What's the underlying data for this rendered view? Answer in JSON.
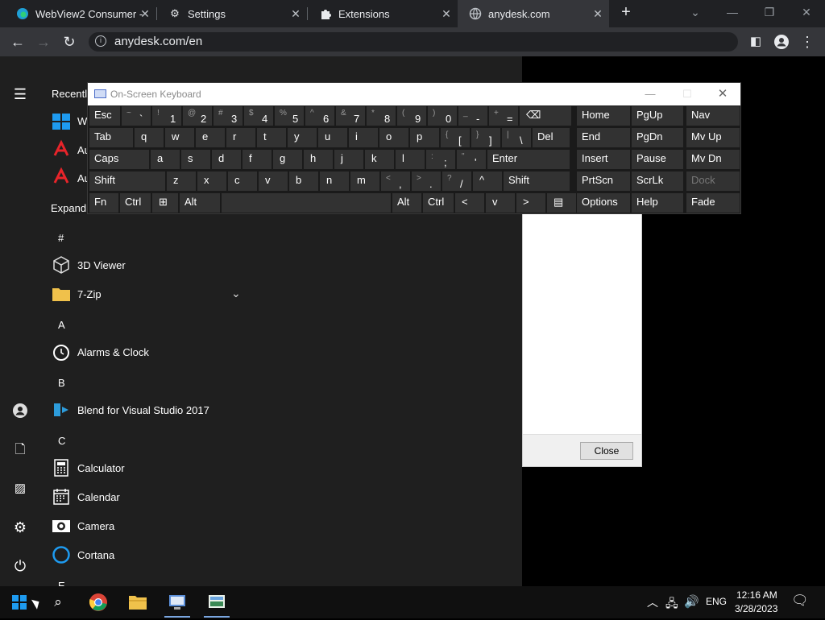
{
  "browser": {
    "tabs": [
      {
        "label": "WebView2 Consumer -",
        "icon": "edge-icon"
      },
      {
        "label": "Settings",
        "icon": "gear-icon"
      },
      {
        "label": "Extensions",
        "icon": "puzzle-icon"
      },
      {
        "label": "anydesk.com",
        "icon": "globe-icon"
      }
    ],
    "url": "anydesk.com/en"
  },
  "start_menu": {
    "recently_label": "Recently",
    "recent_items": [
      "W",
      "Au",
      "Au"
    ],
    "expand_label": "Expand",
    "sections": [
      {
        "letter": "#",
        "apps": [
          {
            "name": "3D Viewer",
            "icon": "cube-icon"
          },
          {
            "name": "7-Zip",
            "icon": "folder-icon"
          }
        ]
      },
      {
        "letter": "A",
        "apps": [
          {
            "name": "Alarms & Clock",
            "icon": "clock-icon"
          }
        ]
      },
      {
        "letter": "B",
        "apps": [
          {
            "name": "Blend for Visual Studio 2017",
            "icon": "blend-icon"
          }
        ]
      },
      {
        "letter": "C",
        "apps": [
          {
            "name": "Calculator",
            "icon": "calculator-icon"
          },
          {
            "name": "Calendar",
            "icon": "calendar-icon"
          },
          {
            "name": "Camera",
            "icon": "camera-icon"
          },
          {
            "name": "Cortana",
            "icon": "cortana-icon"
          }
        ]
      },
      {
        "letter": "E",
        "apps": []
      }
    ]
  },
  "osk": {
    "title": "On-Screen Keyboard",
    "rows": [
      [
        [
          "Esc",
          ""
        ],
        [
          "`",
          "~"
        ],
        [
          "1",
          "!"
        ],
        [
          "2",
          "@"
        ],
        [
          "3",
          "#"
        ],
        [
          "4",
          "$"
        ],
        [
          "5",
          "%"
        ],
        [
          "6",
          "^"
        ],
        [
          "7",
          "&"
        ],
        [
          "8",
          "*"
        ],
        [
          "9",
          "("
        ],
        [
          "0",
          ")"
        ],
        [
          "-",
          "_"
        ],
        [
          "=",
          "+"
        ],
        [
          "⌫",
          ""
        ]
      ],
      [
        [
          "Tab",
          ""
        ],
        [
          "q",
          ""
        ],
        [
          "w",
          ""
        ],
        [
          "e",
          ""
        ],
        [
          "r",
          ""
        ],
        [
          "t",
          ""
        ],
        [
          "y",
          ""
        ],
        [
          "u",
          ""
        ],
        [
          "i",
          ""
        ],
        [
          "o",
          ""
        ],
        [
          "p",
          ""
        ],
        [
          "[",
          "{"
        ],
        [
          "]",
          "}"
        ],
        [
          "\\",
          "|"
        ],
        [
          "Del",
          ""
        ]
      ],
      [
        [
          "Caps",
          ""
        ],
        [
          "a",
          ""
        ],
        [
          "s",
          ""
        ],
        [
          "d",
          ""
        ],
        [
          "f",
          ""
        ],
        [
          "g",
          ""
        ],
        [
          "h",
          ""
        ],
        [
          "j",
          ""
        ],
        [
          "k",
          ""
        ],
        [
          "l",
          ""
        ],
        [
          ";",
          ":"
        ],
        [
          "'",
          "\""
        ],
        [
          "Enter",
          ""
        ]
      ],
      [
        [
          "Shift",
          ""
        ],
        [
          "z",
          ""
        ],
        [
          "x",
          ""
        ],
        [
          "c",
          ""
        ],
        [
          "v",
          ""
        ],
        [
          "b",
          ""
        ],
        [
          "n",
          ""
        ],
        [
          "m",
          ""
        ],
        [
          ",",
          "<"
        ],
        [
          ".",
          ">"
        ],
        [
          "/",
          "?"
        ],
        [
          "^",
          ""
        ],
        [
          "Shift",
          ""
        ]
      ],
      [
        [
          "Fn",
          ""
        ],
        [
          "Ctrl",
          ""
        ],
        [
          "⊞",
          ""
        ],
        [
          "Alt",
          ""
        ],
        [
          "",
          ""
        ],
        [
          "Alt",
          ""
        ],
        [
          "Ctrl",
          ""
        ],
        [
          "<",
          ""
        ],
        [
          "v",
          ""
        ],
        [
          ">",
          ""
        ],
        [
          "▤",
          ""
        ]
      ]
    ],
    "side_keys": [
      [
        "Home",
        "PgUp",
        "Nav"
      ],
      [
        "End",
        "PgDn",
        "Mv Up"
      ],
      [
        "Insert",
        "Pause",
        "Mv Dn"
      ],
      [
        "PrtScn",
        "ScrLk",
        "Dock"
      ],
      [
        "Options",
        "Help",
        "Fade"
      ]
    ]
  },
  "dialog": {
    "close_label": "Close"
  },
  "taskbar": {
    "lang": "ENG",
    "time": "12:16 AM",
    "date": "3/28/2023"
  },
  "colors": {
    "tab_active": "#35363a",
    "tabbar": "#202124",
    "osk_key": "#323232",
    "start_bg": "#1f1f1f",
    "taskbar": "#101010"
  }
}
